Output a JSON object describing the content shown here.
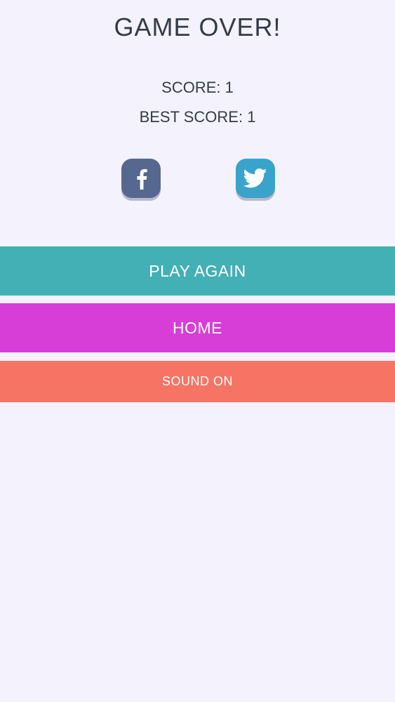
{
  "title": "GAME OVER!",
  "score": {
    "current": "SCORE: 1",
    "best": "BEST SCORE: 1"
  },
  "share": [
    {
      "icon": "facebook-icon",
      "color": "#56688f"
    },
    {
      "icon": "twitter-icon",
      "color": "#3aa3cb"
    }
  ],
  "buttons": {
    "play_again": {
      "label": "PLAY AGAIN",
      "color": "#42b0b4"
    },
    "home": {
      "label": "HOME",
      "color": "#d63ed7"
    },
    "sound": {
      "label": "SOUND ON",
      "color": "#f67464"
    }
  }
}
